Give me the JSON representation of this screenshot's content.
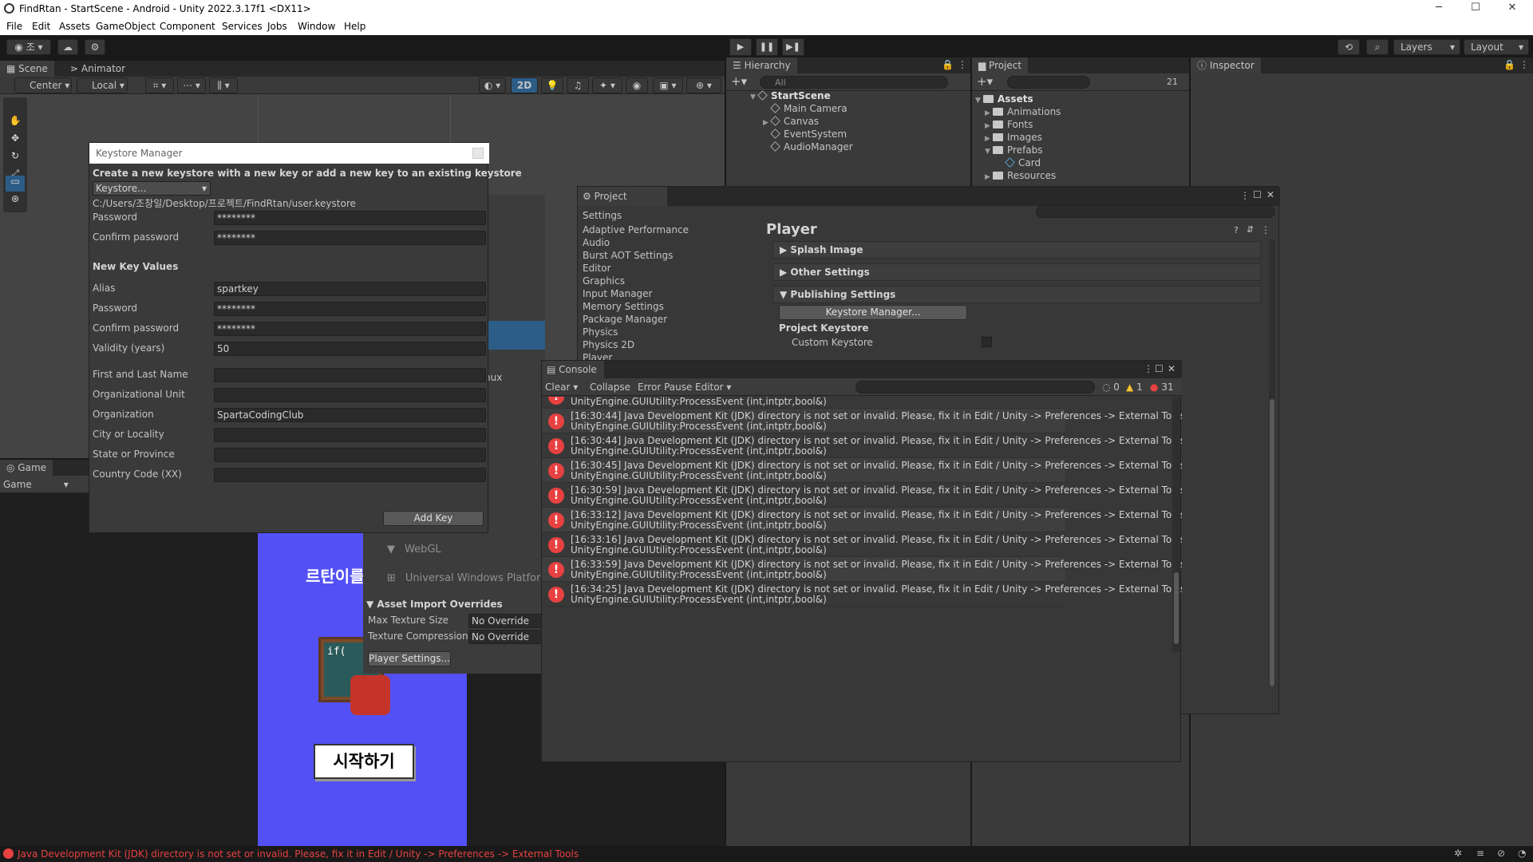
{
  "window": {
    "title": "FindRtan - StartScene - Android - Unity 2022.3.17f1 <DX11>"
  },
  "menu": [
    "File",
    "Edit",
    "Assets",
    "GameObject",
    "Component",
    "Services",
    "Jobs",
    "Window",
    "Help"
  ],
  "toolbar": {
    "layers": "Layers",
    "layout": "Layout"
  },
  "scene": {
    "tabs": [
      "Scene",
      "Animator"
    ],
    "pivot": "Center",
    "space": "Local",
    "mode2d": "2D"
  },
  "game": {
    "tab": "Game",
    "dropdown": "Game",
    "start_button": "시작하기",
    "title_fragment": "르탄이를"
  },
  "hierarchy": {
    "tab": "Hierarchy",
    "search_placeholder": "All",
    "scene": "StartScene",
    "items": [
      "Main Camera",
      "Canvas",
      "EventSystem",
      "AudioManager"
    ]
  },
  "project": {
    "tab": "Project",
    "hidden_count": "21",
    "root": "Assets",
    "items": [
      "Animations",
      "Fonts",
      "Images",
      "Prefabs",
      "Card",
      "Resources"
    ]
  },
  "inspector": {
    "tab": "Inspector"
  },
  "keystore": {
    "title": "Keystore Manager",
    "description": "Create a new keystore with a new key or add a new key to an existing keystore",
    "dropdown": "Keystore...",
    "path": "C:/Users/조창일/Desktop/프로젝트/FindRtan/user.keystore",
    "password_label": "Password",
    "password_value": "********",
    "confirm_label": "Confirm password",
    "confirm_value": "********",
    "new_key_header": "New Key Values",
    "fields": [
      {
        "label": "Alias",
        "value": "spartkey"
      },
      {
        "label": "Password",
        "value": "********"
      },
      {
        "label": "Confirm password",
        "value": "********"
      },
      {
        "label": "Validity (years)",
        "value": "50"
      },
      {
        "label": "First and Last Name",
        "value": ""
      },
      {
        "label": "Organizational Unit",
        "value": ""
      },
      {
        "label": "Organization",
        "value": "SpartaCodingClub"
      },
      {
        "label": "City or Locality",
        "value": ""
      },
      {
        "label": "State or Province",
        "value": ""
      },
      {
        "label": "Country Code (XX)",
        "value": ""
      }
    ],
    "add_key": "Add Key"
  },
  "project_settings": {
    "title": "Project Settings",
    "categories": [
      "Adaptive Performance",
      "Audio",
      "Burst AOT Settings",
      "Editor",
      "Graphics",
      "Input Manager",
      "Memory Settings",
      "Package Manager",
      "Physics",
      "Physics 2D",
      "Player"
    ],
    "header": "Player",
    "sections": [
      "Splash Image",
      "Other Settings",
      "Publishing Settings"
    ],
    "keystore_manager_button": "Keystore Manager...",
    "project_keystore": "Project Keystore",
    "custom_keystore": "Custom Keystore"
  },
  "build_settings": {
    "linux_fragment": "nux",
    "platforms": [
      "WebGL",
      "Universal Windows Platform"
    ],
    "overrides_header": "Asset Import Overrides",
    "max_texture_label": "Max Texture Size",
    "max_texture_value": "No Override",
    "texture_compression_label": "Texture Compression",
    "texture_compression_value": "No Override",
    "player_settings_button": "Player Settings..."
  },
  "console": {
    "tab": "Console",
    "clear": "Clear",
    "collapse": "Collapse",
    "error_pause": "Error Pause",
    "editor": "Editor",
    "log_count": "0",
    "warn_count": "1",
    "error_count": "31",
    "partial_line": "UnityEngine.GUIUtility:ProcessEvent (int,intptr,bool&)",
    "entries": [
      {
        "time": "[16:30:44]",
        "msg": "Java Development Kit (JDK) directory is not set or invalid. Please, fix it in Edit / Unity -> Preferences -> External Tools",
        "trace": "UnityEngine.GUIUtility:ProcessEvent (int,intptr,bool&)"
      },
      {
        "time": "[16:30:44]",
        "msg": "Java Development Kit (JDK) directory is not set or invalid. Please, fix it in Edit / Unity -> Preferences -> External Tools",
        "trace": "UnityEngine.GUIUtility:ProcessEvent (int,intptr,bool&)"
      },
      {
        "time": "[16:30:45]",
        "msg": "Java Development Kit (JDK) directory is not set or invalid. Please, fix it in Edit / Unity -> Preferences -> External Tools",
        "trace": "UnityEngine.GUIUtility:ProcessEvent (int,intptr,bool&)"
      },
      {
        "time": "[16:30:59]",
        "msg": "Java Development Kit (JDK) directory is not set or invalid. Please, fix it in Edit / Unity -> Preferences -> External Tools",
        "trace": "UnityEngine.GUIUtility:ProcessEvent (int,intptr,bool&)"
      },
      {
        "time": "[16:33:12]",
        "msg": "Java Development Kit (JDK) directory is not set or invalid. Please, fix it in Edit / Unity -> Preferences -> External Tools",
        "trace": "UnityEngine.GUIUtility:ProcessEvent (int,intptr,bool&)"
      },
      {
        "time": "[16:33:16]",
        "msg": "Java Development Kit (JDK) directory is not set or invalid. Please, fix it in Edit / Unity -> Preferences -> External Tools",
        "trace": "UnityEngine.GUIUtility:ProcessEvent (int,intptr,bool&)"
      },
      {
        "time": "[16:33:59]",
        "msg": "Java Development Kit (JDK) directory is not set or invalid. Please, fix it in Edit / Unity -> Preferences -> External Tools",
        "trace": "UnityEngine.GUIUtility:ProcessEvent (int,intptr,bool&)"
      },
      {
        "time": "[16:34:25]",
        "msg": "Java Development Kit (JDK) directory is not set or invalid. Please, fix it in Edit / Unity -> Preferences -> External Tools",
        "trace": "UnityEngine.GUIUtility:ProcessEvent (int,intptr,bool&)"
      }
    ]
  },
  "status_bar": {
    "message": "Java Development Kit (JDK) directory is not set or invalid. Please, fix it in Edit / Unity -> Preferences -> External Tools"
  },
  "colors": {
    "error": "#e74141",
    "warning": "#f2c12e",
    "game_bg": "#5351f5",
    "accent_blue": "#2c5d87"
  }
}
